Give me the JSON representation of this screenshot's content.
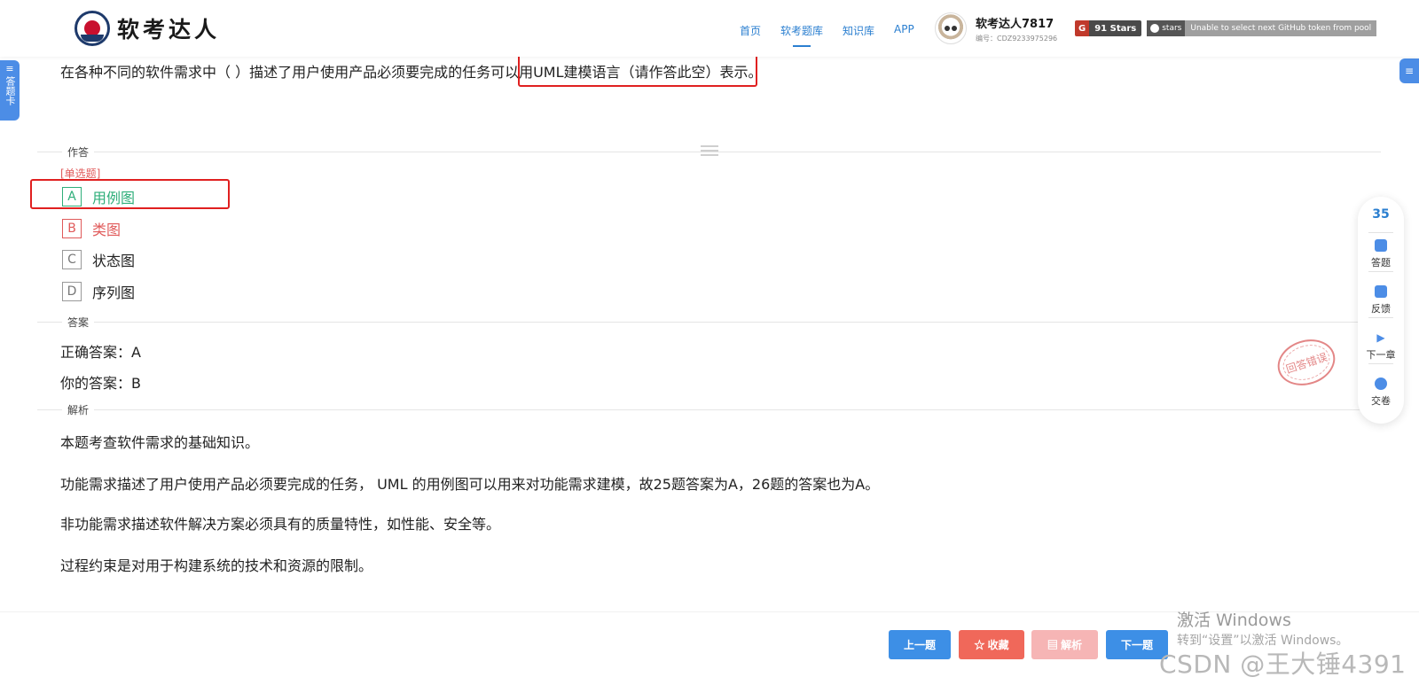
{
  "header": {
    "logo_text": "软考达人",
    "nav": [
      "首页",
      "软考题库",
      "知识库",
      "APP"
    ],
    "active_nav": 1,
    "user_name": "软考达人7817",
    "user_id": "编号：CDZ9233975296",
    "badge_gitee": "91 Stars",
    "badge_github_label": "stars",
    "badge_github_value": "Unable to select next GitHub token from pool"
  },
  "side_left_label": "答题卡",
  "question": {
    "pre": "在各种不同的软件需求中（ ）描述了用户使用产品必须要完成的任务",
    "highlight": "可以用UML建模语言（请作答此空）",
    "post": "表示。"
  },
  "sections": {
    "answer_area": "作答",
    "answer": "答案",
    "analysis": "解析"
  },
  "question_type": "[单选题]",
  "options": [
    {
      "letter": "A",
      "text": "用例图",
      "state": "correct"
    },
    {
      "letter": "B",
      "text": "类图",
      "state": "wrong"
    },
    {
      "letter": "C",
      "text": "状态图",
      "state": "normal"
    },
    {
      "letter": "D",
      "text": "序列图",
      "state": "normal"
    }
  ],
  "correct_answer": "正确答案：A",
  "your_answer": "你的答案：B",
  "stamp": "回答错误",
  "explanation": [
    "本题考查软件需求的基础知识。",
    "功能需求描述了用户使用产品必须要完成的任务， UML 的用例图可以用来对功能需求建模，故25题答案为A，26题的答案也为A。",
    "非功能需求描述软件解决方案必须具有的质量特性，如性能、安全等。",
    "过程约束是对用于构建系统的技术和资源的限制。"
  ],
  "float_panel": {
    "number": "35",
    "items": [
      "答题",
      "反馈",
      "下一章",
      "交卷"
    ]
  },
  "buttons": {
    "prev": "上一题",
    "fav": "☆ 收藏",
    "parse": "▤ 解析",
    "next": "下一题"
  },
  "watermark": {
    "line1": "激活 Windows",
    "line2": "转到“设置”以激活 Windows。",
    "line3": "CSDN @王大锤4391"
  },
  "colors": {
    "accent": "#2b7fd0",
    "correct": "#2fae7a",
    "wrong": "#e05a5a",
    "highlight": "#e02020"
  }
}
